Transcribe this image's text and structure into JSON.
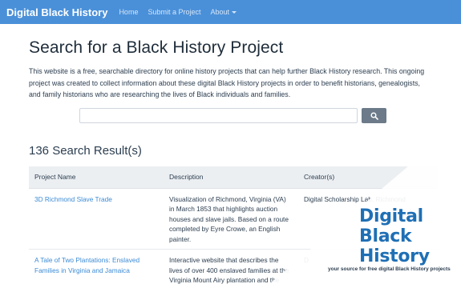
{
  "navbar": {
    "brand": "Digital Black History",
    "links": [
      "Home",
      "Submit a Project",
      "About"
    ]
  },
  "main": {
    "title": "Search for a Black History Project",
    "intro": "This website is a free, searchable directory for online history projects that can help further Black History research. This ongoing project was created to collect information about these digital Black History projects in order to benefit historians, genealogists, and family historians who are researching the lives of Black individuals and families.",
    "search": {
      "value": "",
      "placeholder": ""
    },
    "results_count": "136 Search Result(s)"
  },
  "table": {
    "headers": [
      "Project Name",
      "Description",
      "Creator(s)"
    ],
    "rows": [
      {
        "name": "3D Richmond Slave Trade",
        "description": "Visualization of Richmond, Virginia (VA) in March 1853 that highlights auction houses and slave jails. Based on a route completed by Eyre Crowe, an English painter.",
        "creator": "Digital Scholarship Lab, Richmond"
      },
      {
        "name": "A Tale of Two Plantations: Enslaved Families in Virginia and Jamaica",
        "description": "Interactive website that describes the lives of over 400 enslaved families at the Virginia Mount Airy plantation and the Mesopotamia plantation in Jamaica.",
        "creator": "D"
      }
    ]
  },
  "logo": {
    "line1": "Digital",
    "line2": "Black",
    "line3": "History",
    "tagline": "your source for free digital Black History projects"
  },
  "colors": {
    "navbar": "#4a90d9",
    "link": "#3b8bd6",
    "logo": "#1f6fb5",
    "search_button": "#6c7a89"
  },
  "icons": {
    "search_button": "search-icon",
    "about_menu": "caret-down-icon"
  }
}
